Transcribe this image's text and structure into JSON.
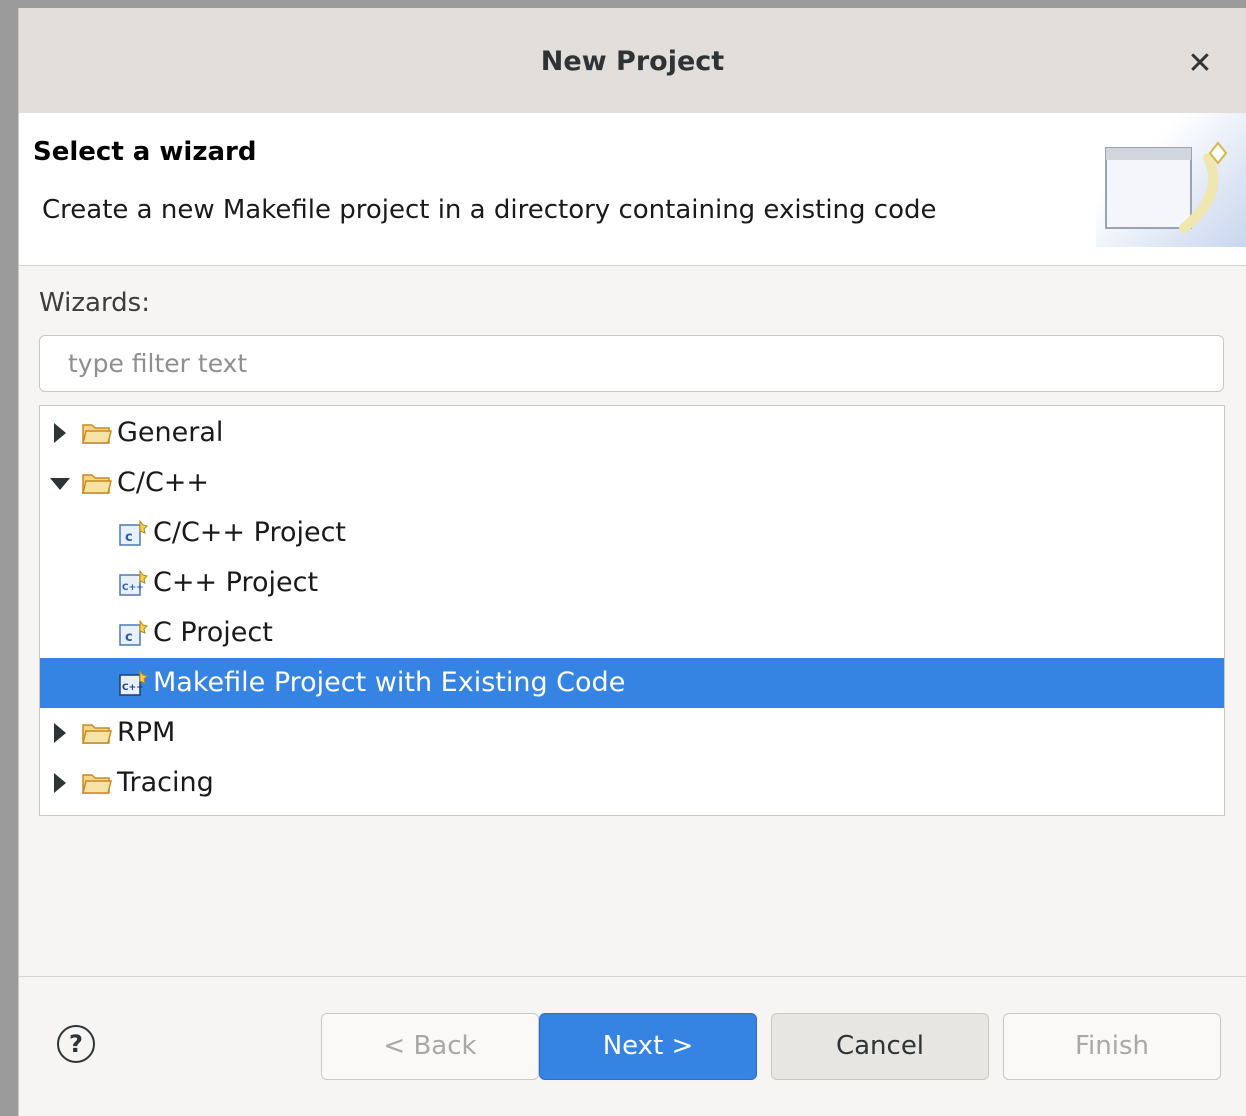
{
  "window": {
    "title": "New Project"
  },
  "header": {
    "title": "Select a wizard",
    "description": "Create a new Makefile project in a directory containing existing code"
  },
  "wizards": {
    "label": "Wizards:",
    "filter_placeholder": "type filter text",
    "filter_value": ""
  },
  "tree": {
    "items": [
      {
        "label": "General",
        "kind": "folder",
        "expanded": false,
        "selected": false
      },
      {
        "label": "C/C++",
        "kind": "folder",
        "expanded": true,
        "selected": false
      },
      {
        "label": "C/C++ Project",
        "kind": "project",
        "icon": "c-project-icon",
        "selected": false
      },
      {
        "label": "C++ Project",
        "kind": "project",
        "icon": "cpp-project-icon",
        "selected": false
      },
      {
        "label": "C Project",
        "kind": "project",
        "icon": "c-project-icon",
        "selected": false
      },
      {
        "label": "Makefile Project with Existing Code",
        "kind": "project",
        "icon": "makefile-project-icon",
        "selected": true
      },
      {
        "label": "RPM",
        "kind": "folder",
        "expanded": false,
        "selected": false
      },
      {
        "label": "Tracing",
        "kind": "folder",
        "expanded": false,
        "selected": false
      }
    ]
  },
  "buttons": {
    "help": "?",
    "back": "< Back",
    "next": "Next >",
    "cancel": "Cancel",
    "finish": "Finish"
  },
  "colors": {
    "accent": "#3584e4",
    "selection": "#3584e4",
    "folder": "#e8a53a"
  }
}
